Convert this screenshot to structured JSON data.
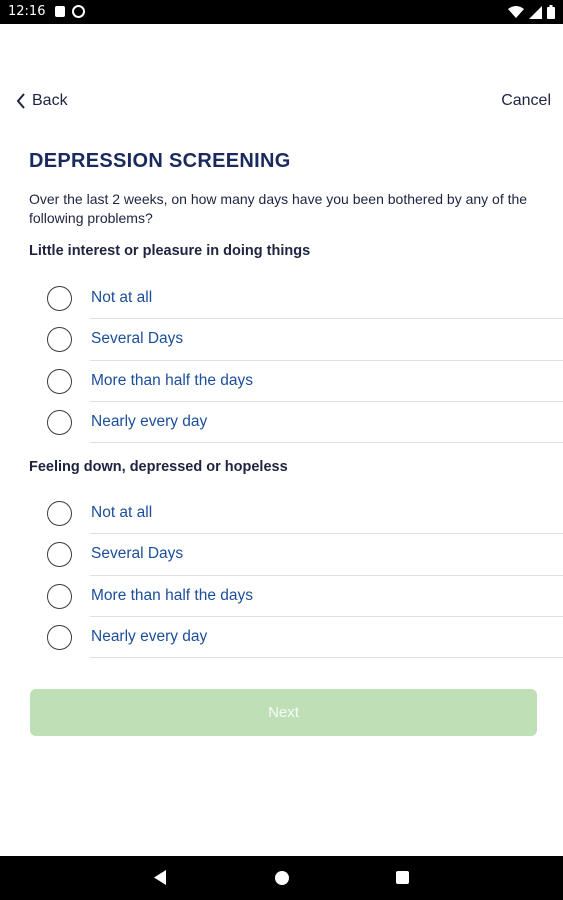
{
  "status_bar": {
    "time": "12:16",
    "icons": [
      "notification-square-icon",
      "data-saver-icon",
      "wifi-icon",
      "signal-icon",
      "battery-icon"
    ]
  },
  "header": {
    "back_label": "Back",
    "cancel_label": "Cancel"
  },
  "screening": {
    "title": "DEPRESSION SCREENING",
    "intro": "Over the last 2 weeks, on how many days have you been bothered by any of the following problems?",
    "questions": [
      {
        "text": "Little interest or pleasure in doing things",
        "options": [
          "Not at all",
          "Several Days",
          "More than half the days",
          "Nearly every day"
        ],
        "selected": null
      },
      {
        "text": "Feeling down, depressed or hopeless",
        "options": [
          "Not at all",
          "Several Days",
          "More than half the days",
          "Nearly every day"
        ],
        "selected": null
      }
    ]
  },
  "footer": {
    "next_label": "Next",
    "next_enabled": false
  },
  "colors": {
    "title": "#1b2a5e",
    "option_text": "#1c4e9a",
    "next_disabled_bg": "#bfe0b7"
  }
}
